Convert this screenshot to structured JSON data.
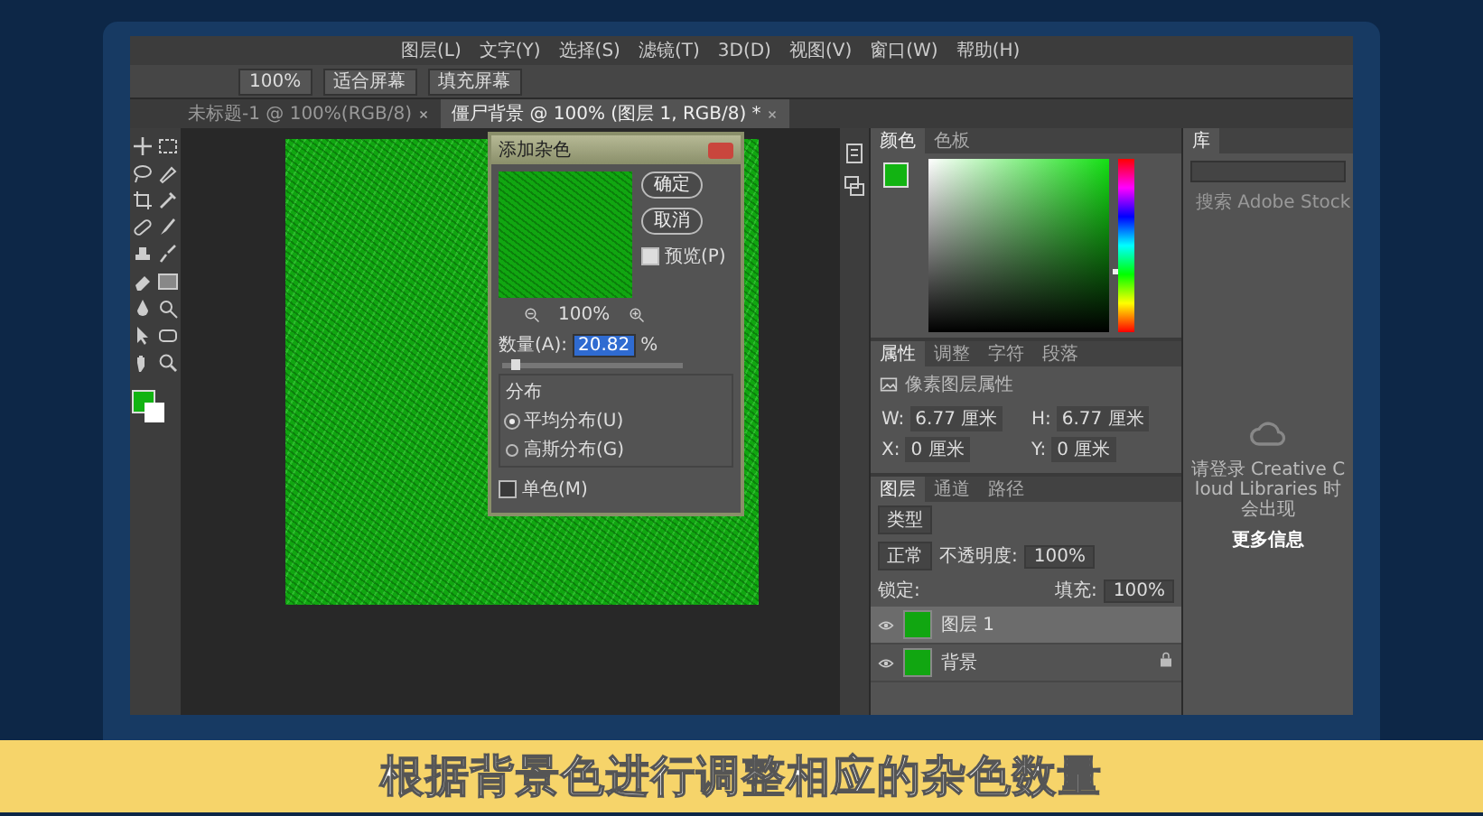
{
  "menu": [
    "图层(L)",
    "文字(Y)",
    "选择(S)",
    "滤镜(T)",
    "3D(D)",
    "视图(V)",
    "窗口(W)",
    "帮助(H)"
  ],
  "options_bar": {
    "zoom": "100%",
    "buttons": [
      "适合屏幕",
      "填充屏幕"
    ]
  },
  "document_tabs": [
    {
      "label": "未标题-1 @ 100%(RGB/8)",
      "selected": false
    },
    {
      "label": "僵尸背景 @ 100% (图层 1, RGB/8) *",
      "selected": true
    }
  ],
  "dialog": {
    "title": "添加杂色",
    "buttons": [
      "确定",
      "取消"
    ],
    "preview": {
      "label": "预览(P)",
      "checked": true
    },
    "zoom": "100%",
    "amount": {
      "label": "数量(A):",
      "value": "20.82",
      "unit": "%",
      "level": 0.05
    },
    "distribution": {
      "label": "分布",
      "options": [
        {
          "label": "平均分布(U)",
          "selected": true
        },
        {
          "label": "高斯分布(G)",
          "selected": false
        }
      ]
    },
    "monochrome": {
      "label": "单色(M)",
      "checked": false
    }
  },
  "color_panel": {
    "tabs": [
      {
        "label": "颜色",
        "selected": true
      },
      {
        "label": "色板",
        "selected": false
      }
    ],
    "hue": {
      "level": 0.35
    }
  },
  "properties_panel": {
    "tabs": [
      {
        "label": "属性",
        "selected": true
      },
      {
        "label": "调整",
        "selected": false
      },
      {
        "label": "字符",
        "selected": false
      },
      {
        "label": "段落",
        "selected": false
      }
    ],
    "heading": "像素图层属性",
    "fields": [
      {
        "label": "W:",
        "value": "6.77 厘米"
      },
      {
        "label": "H:",
        "value": "6.77 厘米"
      },
      {
        "label": "X:",
        "value": "0 厘米"
      },
      {
        "label": "Y:",
        "value": "0 厘米"
      }
    ]
  },
  "layers_panel": {
    "tabs": [
      {
        "label": "图层",
        "selected": true
      },
      {
        "label": "通道",
        "selected": false
      },
      {
        "label": "路径",
        "selected": false
      }
    ],
    "filter": "类型",
    "blend_mode": "正常",
    "opacity_label": "不透明度:",
    "opacity": "100%",
    "lock_label": "锁定:",
    "fill_label": "填充:",
    "fill": "100%",
    "layers": [
      {
        "name": "图层 1",
        "selected": true,
        "locked": false
      },
      {
        "name": "背景",
        "selected": false,
        "locked": true
      }
    ]
  },
  "libraries_panel": {
    "tab": "库",
    "search_placeholder": "搜索 Adobe Stock",
    "message": "请登录 Creative Cloud Libraries 时会出现",
    "link": "更多信息"
  },
  "caption": "根据背景色进行调整相应的杂色数量"
}
